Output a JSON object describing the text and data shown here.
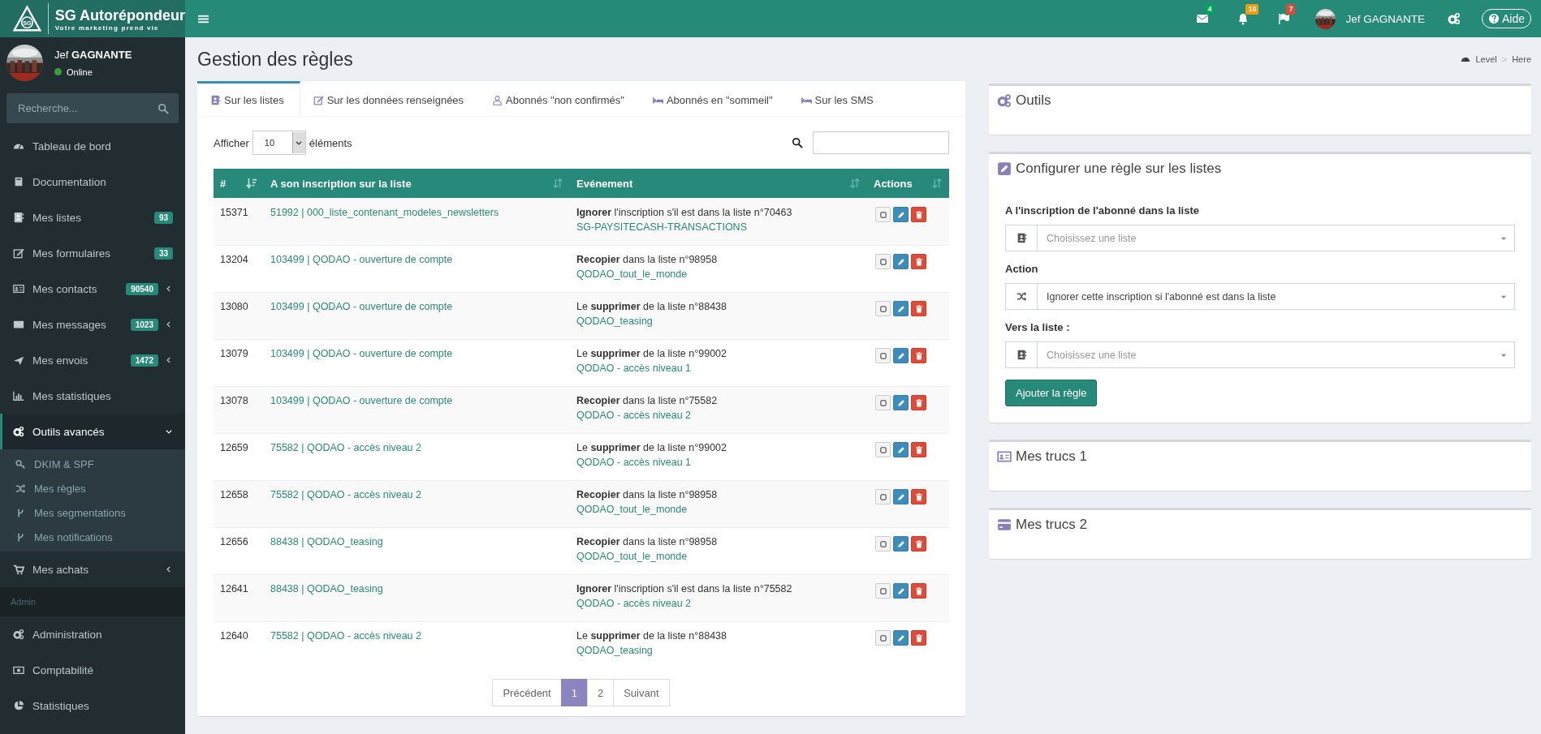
{
  "brand": {
    "name": "SG Autorépondeur",
    "tagline": "Votre marketing prend vie",
    "logo_text": "SG"
  },
  "topbar": {
    "notifications": [
      {
        "count": "4",
        "color": "#00a65a"
      },
      {
        "count": "10",
        "color": "#f39c12"
      },
      {
        "count": "7",
        "color": "#dd4b39"
      }
    ],
    "user": "Jef GAGNANTE",
    "help": "Aide"
  },
  "user_panel": {
    "first_name": "Jef",
    "last_name": "GAGNANTE",
    "status": "Online"
  },
  "sidebar": {
    "search": {
      "placeholder": "Recherche..."
    },
    "sections": [
      {
        "items": [
          {
            "label": "Tableau de bord",
            "selected": false
          },
          {
            "label": "Documentation",
            "selected": false
          },
          {
            "label": "Mes listes",
            "badge": "93",
            "selected": false
          },
          {
            "label": "Mes formulaires",
            "badge": "33",
            "selected": false
          },
          {
            "label": "Mes contacts",
            "badge": "90540",
            "expanded": false,
            "selected": false
          },
          {
            "label": "Mes messages",
            "badge": "1023",
            "expanded": false,
            "selected": false
          },
          {
            "label": "Mes envois",
            "badge": "1472",
            "expanded": false,
            "selected": false
          },
          {
            "label": "Mes statistiques",
            "selected": false
          },
          {
            "label": "Outils avancés",
            "expanded": true,
            "selected": true,
            "children": [
              {
                "label": "DKIM & SPF",
                "selected": false
              },
              {
                "label": "Mes règles",
                "selected": false
              },
              {
                "label": "Mes segmentations",
                "selected": false
              },
              {
                "label": "Mes notifications",
                "selected": false
              }
            ]
          },
          {
            "label": "Mes achats",
            "expanded": false,
            "selected": false
          }
        ]
      },
      {
        "header": "Admin",
        "items": [
          {
            "label": "Administration",
            "selected": false
          },
          {
            "label": "Comptabilité",
            "selected": false
          },
          {
            "label": "Statistiques",
            "selected": false
          }
        ]
      }
    ]
  },
  "page": {
    "title": "Gestion des règles",
    "breadcrumb": [
      "Level",
      ">",
      "Here"
    ]
  },
  "tabs": [
    {
      "label": "Sur les listes",
      "selected": true
    },
    {
      "label": "Sur les données renseignées",
      "selected": false
    },
    {
      "label": "Abonnés \"non confirmés\"",
      "selected": false
    },
    {
      "label": "Abonnés en \"sommeil\"",
      "selected": false
    },
    {
      "label": "Sur les SMS",
      "selected": false
    }
  ],
  "table": {
    "length_label": "Afficher",
    "length_value": "10",
    "length_suffix": "éléments",
    "columns": [
      "#",
      "A son inscription sur la liste",
      "Evénement",
      "Actions"
    ],
    "rows": [
      {
        "id": "15371",
        "list": "51992 | 000_liste_contenant_modeles_newsletters",
        "event": "**Ignorer** l'inscription s'il est dans la liste n°70463",
        "event_list": "SG-PAYSITECASH-TRANSACTIONS"
      },
      {
        "id": "13204",
        "list": "103499 | QODAO - ouverture de compte",
        "event": "**Recopier** dans la liste n°98958",
        "event_list": "QODAO_tout_le_monde"
      },
      {
        "id": "13080",
        "list": "103499 | QODAO - ouverture de compte",
        "event": "Le **supprimer** de la liste n°88438",
        "event_list": "QODAO_teasing"
      },
      {
        "id": "13079",
        "list": "103499 | QODAO - ouverture de compte",
        "event": "Le **supprimer** de la liste n°99002",
        "event_list": "QODAO - accès niveau 1"
      },
      {
        "id": "13078",
        "list": "103499 | QODAO - ouverture de compte",
        "event": "**Recopier** dans la liste n°75582",
        "event_list": "QODAO - accès niveau 2"
      },
      {
        "id": "12659",
        "list": "75582 | QODAO - accès niveau 2",
        "event": "Le **supprimer** de la liste n°99002",
        "event_list": "QODAO - accès niveau 1"
      },
      {
        "id": "12658",
        "list": "75582 | QODAO - accès niveau 2",
        "event": "**Recopier** dans la liste n°98958",
        "event_list": "QODAO_tout_le_monde"
      },
      {
        "id": "12656",
        "list": "88438 | QODAO_teasing",
        "event": "**Recopier** dans la liste n°98958",
        "event_list": "QODAO_tout_le_monde"
      },
      {
        "id": "12641",
        "list": "88438 | QODAO_teasing",
        "event": "**Ignorer** l'inscription s'il est dans la liste n°75582",
        "event_list": "QODAO - accès niveau 2"
      },
      {
        "id": "12640",
        "list": "75582 | QODAO - accès niveau 2",
        "event": "Le **supprimer** de la liste n°88438",
        "event_list": "QODAO_teasing"
      }
    ]
  },
  "pagination": {
    "previous": "Précédent",
    "next": "Suivant",
    "pages": [
      {
        "label": "1",
        "selected": true
      },
      {
        "label": "2",
        "selected": false
      }
    ]
  },
  "panels": [
    {
      "title": "Outils"
    },
    {
      "title": "Configurer une règle sur les listes",
      "form": {
        "fields": [
          {
            "label": "A l'inscription de l'abonné dans la liste",
            "placeholder": "Choisissez une liste"
          },
          {
            "label": "Action",
            "value": "Ignorer cette inscription si l'abonné est dans la liste"
          },
          {
            "label": "Vers la liste :",
            "placeholder": "Choisissez une liste"
          }
        ],
        "submit": "Ajouter la règle"
      }
    },
    {
      "title": "Mes trucs 1"
    },
    {
      "title": "Mes trucs 2"
    }
  ]
}
